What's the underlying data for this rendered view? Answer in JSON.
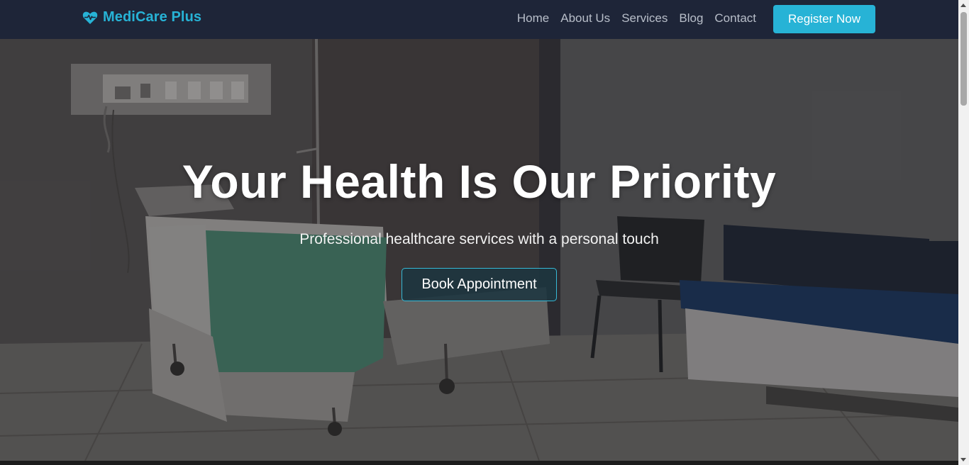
{
  "brand": {
    "name": "MediCare Plus",
    "icon": "heart-pulse-icon",
    "color": "#27b3d6"
  },
  "nav": {
    "links": [
      "Home",
      "About Us",
      "Services",
      "Blog",
      "Contact"
    ],
    "register_label": "Register Now"
  },
  "hero": {
    "title": "Your Health Is Our Priority",
    "subtitle": "Professional healthcare services with a personal touch",
    "cta_label": "Book Appointment",
    "background": "hospital-room-photo"
  },
  "colors": {
    "navbar": "#1e2538",
    "accent": "#27b3d6",
    "button_border": "#36b9d6"
  }
}
